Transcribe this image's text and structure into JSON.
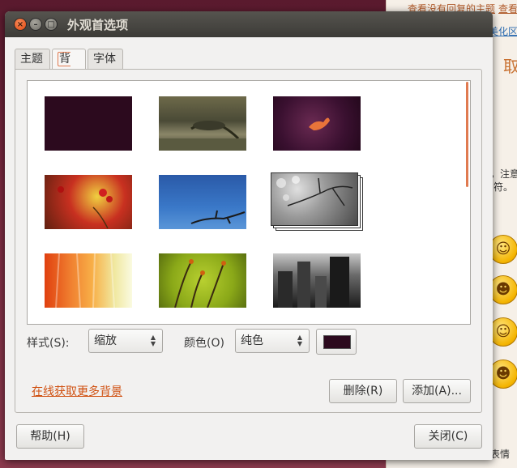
{
  "background_page": {
    "link_unanswered": "查看没有回复的主题",
    "link_view": "查看",
    "sidebar_fragment": "美化区",
    "big_char": "取",
    "text_line1": "，注意",
    "text_line2": "符。",
    "text_bottom": "表情",
    "emoji_icons": [
      "smile-icon",
      "laugh-icon",
      "sweat-icon",
      "grin-icon"
    ]
  },
  "window": {
    "title": "外观首选项",
    "close_glyph": "×",
    "min_glyph": "–",
    "max_glyph": "□"
  },
  "tabs": [
    {
      "label": "主题"
    },
    {
      "label": "背景"
    },
    {
      "label": "字体"
    }
  ],
  "wallpapers": [
    "wallpaper-plain-purple",
    "wallpaper-tree-field",
    "wallpaper-bird-purple",
    "wallpaper-red-berries",
    "wallpaper-blue-sky-branch",
    "wallpaper-bokeh-branch-selected",
    "wallpaper-orange-fabric",
    "wallpaper-green-stems",
    "wallpaper-city-buildings"
  ],
  "style": {
    "label": "样式(S):",
    "value": "缩放"
  },
  "color": {
    "label": "颜色(O)",
    "value": "纯色",
    "swatch": "#2c0a1e"
  },
  "online_link": "在线获取更多背景",
  "buttons": {
    "remove": "删除(R)",
    "add": "添加(A)...",
    "help": "帮助(H)",
    "close": "关闭(C)"
  },
  "colors": {
    "accent": "#e07a50",
    "link": "#d05010",
    "titlebar": "#3c3b37"
  }
}
